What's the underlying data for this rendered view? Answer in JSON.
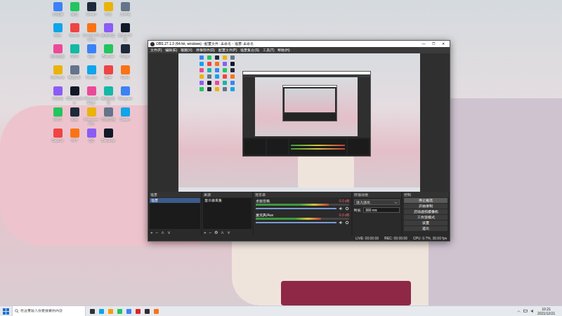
{
  "desktop": {
    "icons": [
      {
        "label": "此电脑"
      },
      {
        "label": "微信"
      },
      {
        "label": "Steam"
      },
      {
        "label": "夸克"
      },
      {
        "label": "文件夹"
      },
      {
        "label": "网络"
      },
      {
        "label": "Steam"
      },
      {
        "label": "Google Chrome"
      },
      {
        "label": "百度网盘"
      },
      {
        "label": "新建文件夹"
      },
      {
        "label": "控制面板"
      },
      {
        "label": "GOG"
      },
      {
        "label": "Epic"
      },
      {
        "label": "Blender"
      },
      {
        "label": "Origin"
      },
      {
        "label": "GeForce"
      },
      {
        "label": "网易UU"
      },
      {
        "label": "Firefox"
      },
      {
        "label": "雷神"
      },
      {
        "label": "Geek"
      },
      {
        "label": "回收站"
      },
      {
        "label": "OBS Studio"
      },
      {
        "label": "Microsoft Edge"
      },
      {
        "label": "网易云音乐"
      },
      {
        "label": "Telegram"
      },
      {
        "label": "WPS"
      },
      {
        "label": "剪映"
      },
      {
        "label": "Premiere Pro"
      },
      {
        "label": "哔哩哔哩"
      },
      {
        "label": "Steam"
      },
      {
        "label": "CapCut"
      },
      {
        "label": "PPT"
      },
      {
        "label": "QQ"
      },
      {
        "label": "Bandizip"
      }
    ]
  },
  "obs": {
    "title": "OBS 27.1.3 (64-bit, windows) - 配置文件: 未命名 - 场景: 未命名",
    "window_buttons": [
      "—",
      "☐",
      "✕"
    ],
    "menu": [
      "文件(F)",
      "编辑(E)",
      "视图(V)",
      "停靠部件(D)",
      "配置文件(P)",
      "场景集合(S)",
      "工具(T)",
      "帮助(H)"
    ],
    "scenes": {
      "title": "场景",
      "items": [
        {
          "label": "场景",
          "selected": true
        }
      ],
      "toolbar": [
        "+",
        "−",
        "∧",
        "∨"
      ]
    },
    "sources": {
      "title": "来源",
      "items": [
        {
          "label": "显示器采集",
          "selected": false
        }
      ],
      "toolbar": [
        "+",
        "−",
        "⚙",
        "∧",
        "∨"
      ]
    },
    "mixer": {
      "title": "混音器",
      "channels": [
        {
          "name": "桌面音频",
          "reading": "0.0 dB",
          "level": 0.78,
          "volume": 1,
          "muted": false
        },
        {
          "name": "麦克风/Aux",
          "reading": "0.0 dB",
          "level": 0.7,
          "volume": 1,
          "muted": false
        }
      ]
    },
    "transitions": {
      "title": "转场动画",
      "selected": "淡入淡出",
      "duration_label": "时长",
      "duration": "300 ms"
    },
    "controls": {
      "title": "控制",
      "buttons": [
        {
          "label": "停止推流",
          "active": true
        },
        {
          "label": "开始录制",
          "active": false
        },
        {
          "label": "启动虚拟摄像机",
          "active": false
        },
        {
          "label": "工作室模式",
          "active": false
        },
        {
          "label": "设置",
          "active": false
        },
        {
          "label": "退出",
          "active": false
        }
      ]
    },
    "status": [
      "LIVE: 00:00:00",
      "REC: 00:00:00",
      "CPU: 0.7%, 30.00 fps"
    ]
  },
  "taskbar": {
    "search": {
      "placeholder": "在这里输入你要搜索的内容"
    },
    "time": "10:21",
    "date": "2021/12/21"
  }
}
